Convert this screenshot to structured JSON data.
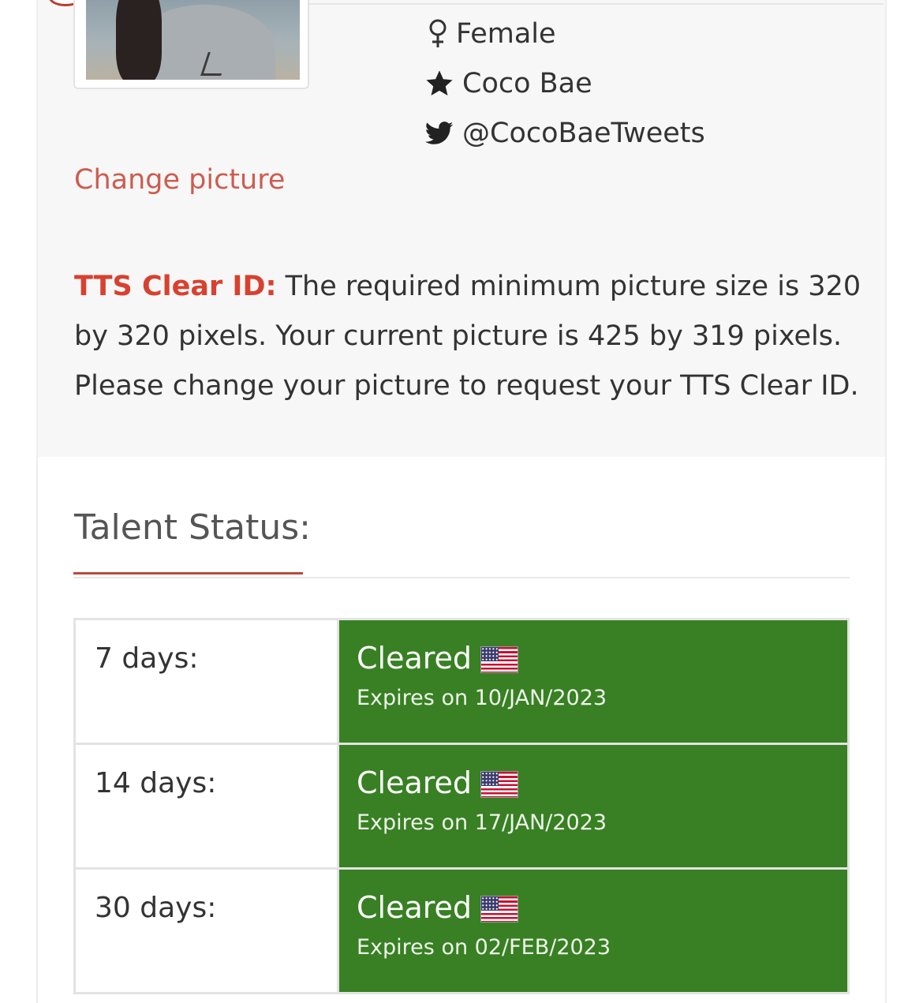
{
  "profile": {
    "gender": "Female",
    "name": "Coco Bae",
    "twitter": "@CocoBaeTweets",
    "change_picture_link": "Change picture"
  },
  "notice": {
    "label": "TTS Clear ID:",
    "text": " The required minimum picture size is 320 by 320 pixels. Your current picture is 425 by 319 pixels. Please change your picture to request your TTS Clear ID."
  },
  "talent_status": {
    "title": "Talent Status:",
    "rows": [
      {
        "period": "7 days:",
        "status": "Cleared",
        "expires": "Expires on 10/JAN/2023",
        "flag": "us-flag-icon"
      },
      {
        "period": "14 days:",
        "status": "Cleared",
        "expires": "Expires on 17/JAN/2023",
        "flag": "us-flag-icon"
      },
      {
        "period": "30 days:",
        "status": "Cleared",
        "expires": "Expires on 02/FEB/2023",
        "flag": "us-flag-icon"
      }
    ]
  },
  "colors": {
    "accent_red": "#d8412f",
    "link_red": "#cd5c4f",
    "cleared_green": "#388023",
    "panel_grey": "#f7f7f7"
  }
}
